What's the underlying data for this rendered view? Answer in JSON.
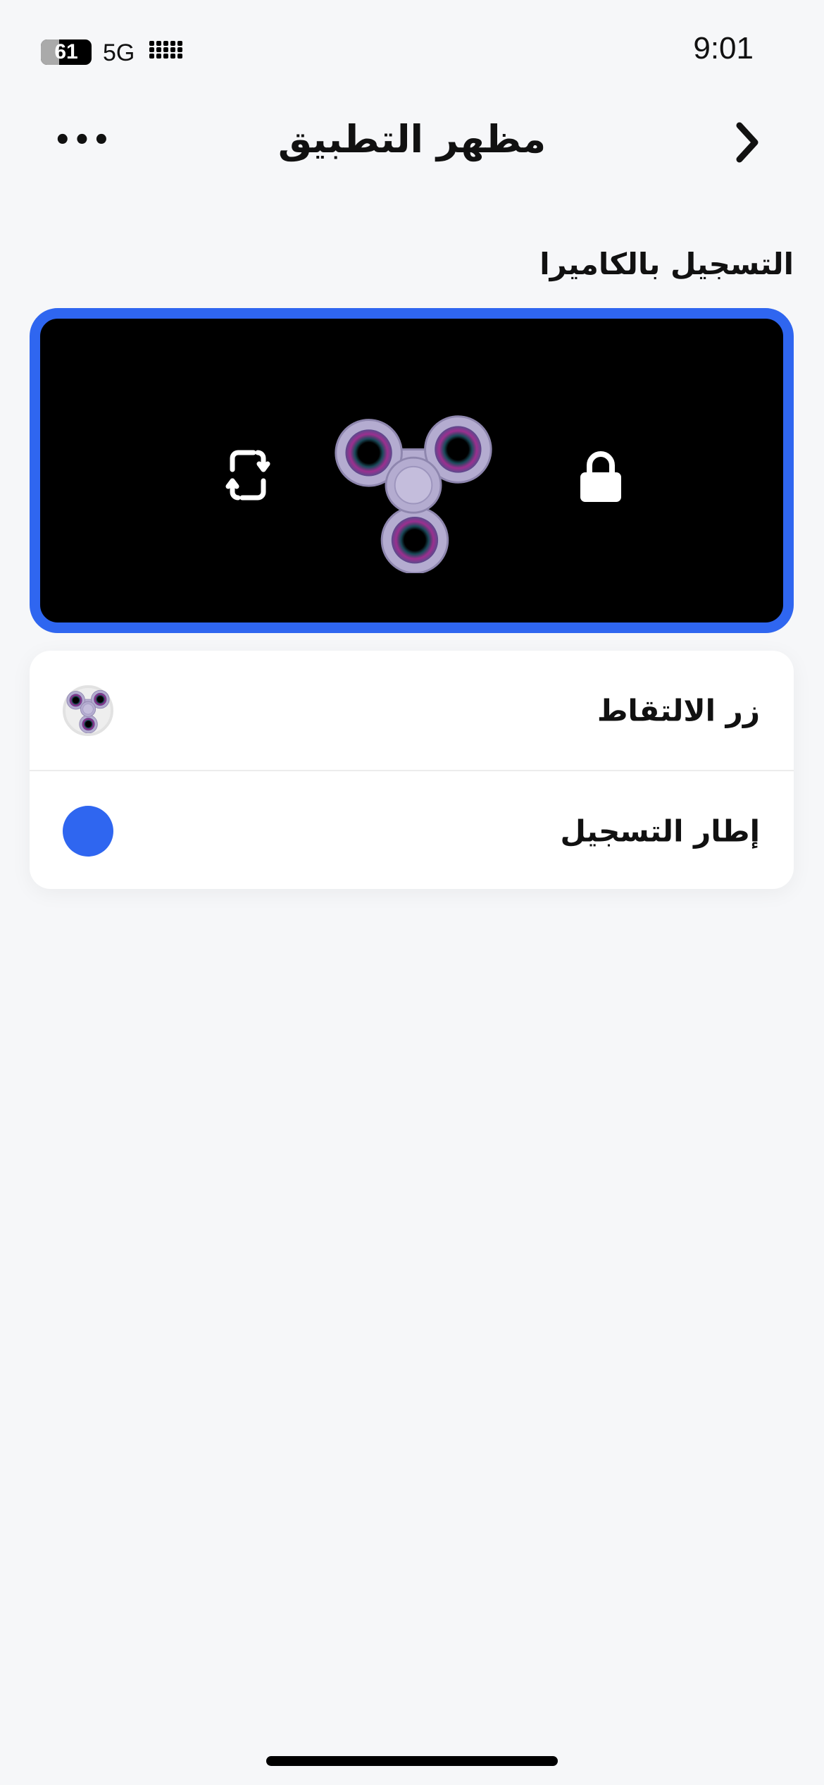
{
  "status_bar": {
    "time": "9:01",
    "battery": "61",
    "network": "5G"
  },
  "header": {
    "title": "مظهر التطبيق",
    "more_icon": "ellipsis-icon",
    "back_icon": "chevron-right-icon"
  },
  "section": {
    "title": "التسجيل بالكاميرا"
  },
  "preview": {
    "frame_color": "#2f66f0",
    "left_icon": "rotate-icon",
    "center_icon": "fidget-spinner",
    "right_icon": "lock-icon"
  },
  "settings": [
    {
      "label": "زر الالتقاط",
      "value_icon": "fidget-spinner-thumbnail"
    },
    {
      "label": "إطار التسجيل",
      "value_color": "#2f66f0"
    }
  ]
}
